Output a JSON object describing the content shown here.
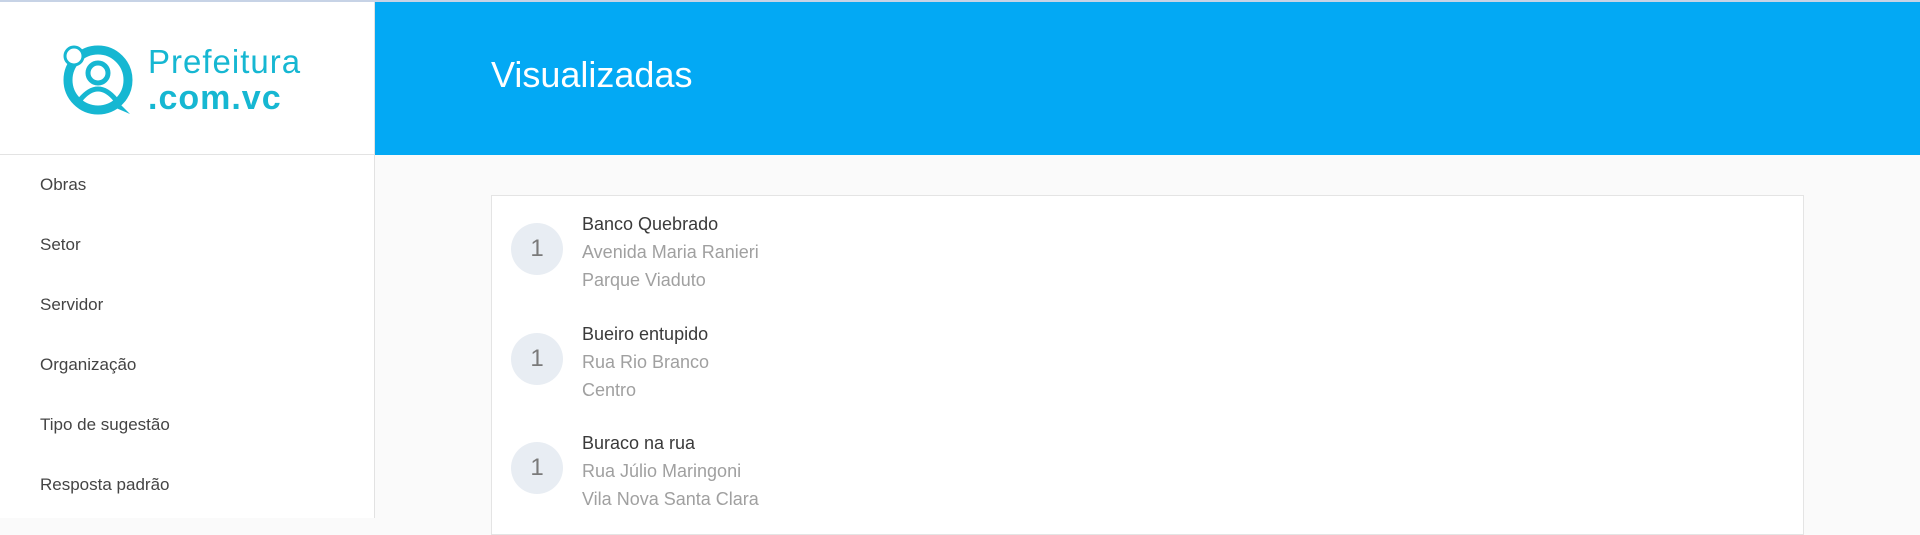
{
  "brand": {
    "line1": "Prefeitura",
    "line2": ".com.vc",
    "color": "#16b7d2"
  },
  "nav": {
    "items": [
      {
        "label": "Obras"
      },
      {
        "label": "Setor"
      },
      {
        "label": "Servidor"
      },
      {
        "label": "Organização"
      },
      {
        "label": "Tipo de sugestão"
      },
      {
        "label": "Resposta padrão"
      }
    ]
  },
  "header": {
    "title": "Visualizadas",
    "color": "#03a9f4"
  },
  "list": {
    "items": [
      {
        "count": "1",
        "title": "Banco Quebrado",
        "street": "Avenida Maria Ranieri",
        "district": "Parque Viaduto"
      },
      {
        "count": "1",
        "title": "Bueiro entupido",
        "street": "Rua Rio Branco",
        "district": "Centro"
      },
      {
        "count": "1",
        "title": "Buraco na rua",
        "street": "Rua Júlio Maringoni",
        "district": "Vila Nova Santa Clara"
      }
    ]
  }
}
